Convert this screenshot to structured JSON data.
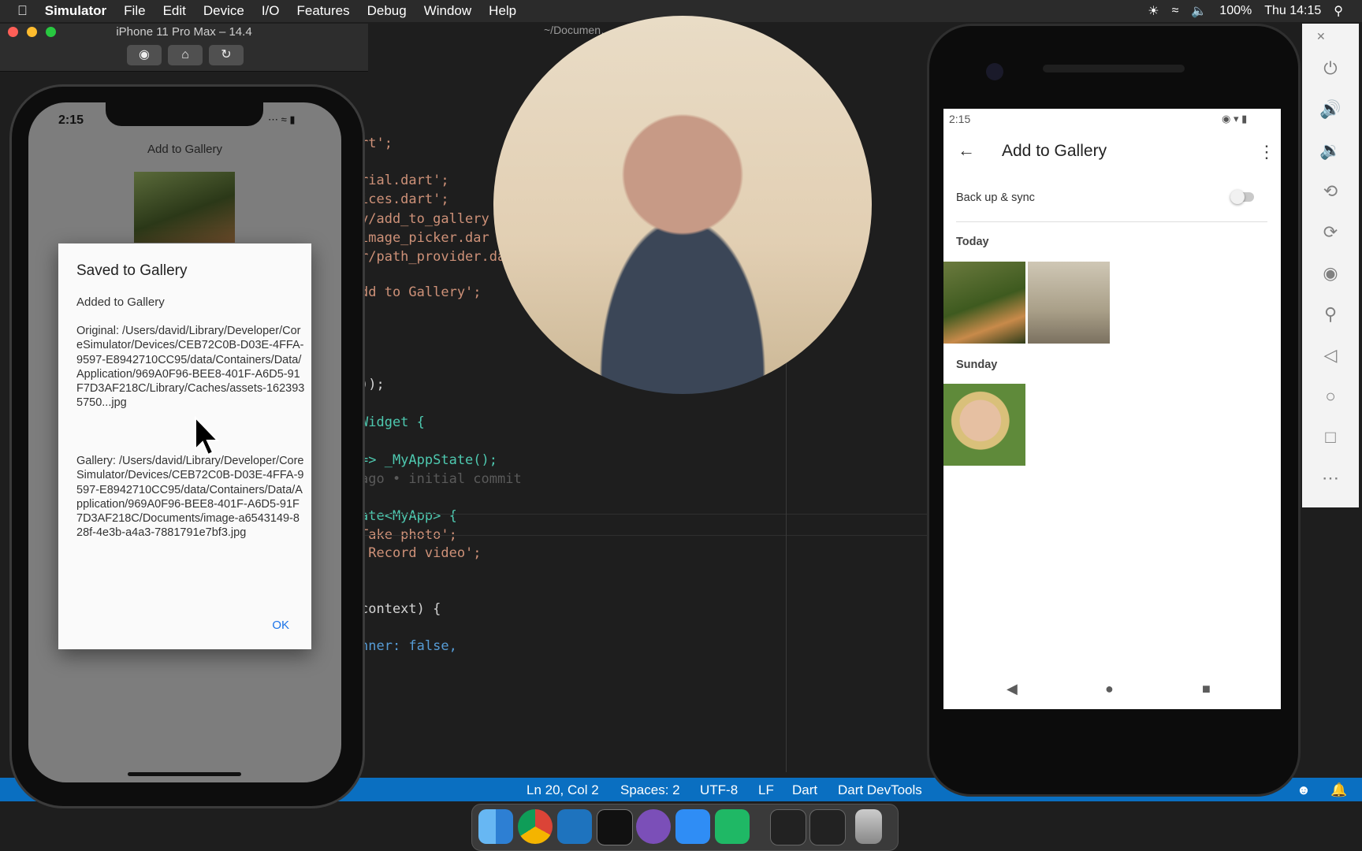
{
  "menubar": {
    "app": "Simulator",
    "items": [
      "File",
      "Edit",
      "Device",
      "I/O",
      "Features",
      "Debug",
      "Window",
      "Help"
    ],
    "battery": "100%",
    "clock": "Thu 14:15"
  },
  "editor": {
    "title": "~/Documen…                    …lib/main.dart",
    "lines": [
      {
        "text": "rt';",
        "cls": "c-str"
      },
      {
        "text": "rial.dart';",
        "cls": "c-str"
      },
      {
        "text": "ices.dart';",
        "cls": "c-str"
      },
      {
        "text": "y/add_to_gallery",
        "cls": "c-str"
      },
      {
        "text": "image_picker.dar",
        "cls": "c-str"
      },
      {
        "text": "r/path_provider.da",
        "cls": "c-str"
      },
      {
        "text": "dd to Gallery';",
        "cls": "c-str"
      },
      {
        "text": "));",
        "cls": "c-pl"
      },
      {
        "text": "Widget {",
        "cls": "c-ty"
      },
      {
        "text": "=> _MyAppState();",
        "cls": "c-ty"
      },
      {
        "text": "ago • initial commit",
        "cls": "c-dim"
      },
      {
        "text": "ate<MyApp> {",
        "cls": "c-ty"
      },
      {
        "text": "Take photo';",
        "cls": "c-str"
      },
      {
        "text": "'Record video';",
        "cls": "c-str"
      },
      {
        "text": "context) {",
        "cls": "c-pl"
      },
      {
        "text": "nner: false,",
        "cls": "c-kw"
      }
    ]
  },
  "statusbar": {
    "position": "Ln 20, Col 2",
    "spaces": "Spaces: 2",
    "encoding": "UTF-8",
    "eol": "LF",
    "language": "Dart",
    "devtools": "Dart DevTools"
  },
  "simulator": {
    "title": "iPhone 11 Pro Max – 14.4",
    "screenshot_icon": "camera-icon",
    "home_icon": "home-icon",
    "rotate_icon": "rotate-icon"
  },
  "ios_app": {
    "time": "2:15",
    "title": "Add to Gallery",
    "dialog": {
      "title": "Saved to Gallery",
      "subtitle": "Added to Gallery",
      "original": "Original: /Users/david/Library/Developer/CoreSimulator/Devices/CEB72C0B-D03E-4FFA-9597-E8942710CC95/data/Containers/Data/Application/969A0F96-BEE8-401F-A6D5-91F7D3AF218C/Library/Caches/assets-1623935750...jpg",
      "gallery": "Gallery: /Users/david/Library/Developer/CoreSimulator/Devices/CEB72C0B-D03E-4FFA-9597-E8942710CC95/data/Containers/Data/Application/969A0F96-BEE8-401F-A6D5-91F7D3AF218C/Documents/image-a6543149-828f-4e3b-a4a3-7881791e7bf3.jpg",
      "ok": "OK"
    }
  },
  "android_app": {
    "time": "2:15",
    "title": "Add to Gallery",
    "sync_label": "Back up & sync",
    "sync_on": false,
    "section_today": "Today",
    "section_sunday": "Sunday"
  },
  "colors": {
    "statusbar": "#0a6fc1",
    "accent": "#1a73e8"
  }
}
